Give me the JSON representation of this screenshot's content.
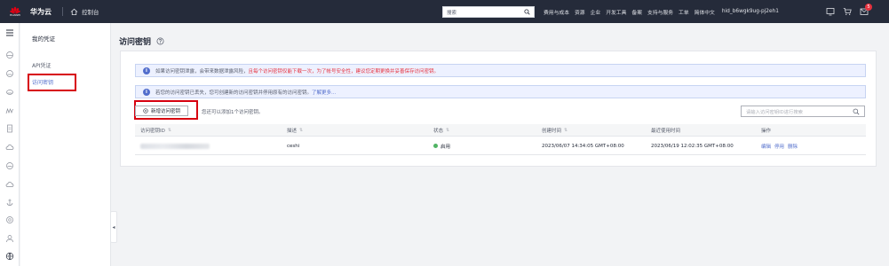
{
  "topbar": {
    "logo_text": "HUAWEI",
    "brand": "华为云",
    "console": "控制台",
    "search_placeholder": "搜索",
    "nav": [
      "费用与成本",
      "资源",
      "企业",
      "开发工具",
      "备案",
      "支持与服务",
      "工单",
      "简体中文"
    ],
    "user": "hid_b6wgk9ug-pj2eh1",
    "notification_count": "5"
  },
  "subnav": {
    "title": "我的凭证",
    "items": [
      "API凭证",
      "访问密钥"
    ]
  },
  "page": {
    "title": "访问密钥"
  },
  "notices": {
    "n1_prefix": "如果访问密钥泄露，会带来数据泄露风险，",
    "n1_red": "且每个访问密钥仅能下载一次，为了帐号安全性，建议您定期更换并妥善保存访问密钥。",
    "n2_text": "若您的访问密钥已丢失，您可创建新的访问密钥并停用原有的访问密钥。",
    "n2_link": "了解更多..."
  },
  "toolbar": {
    "create_label": "新增访问密钥",
    "quota_text": "您还可以添加1个访问密钥。",
    "search_placeholder": "请输入访问密钥ID进行搜索"
  },
  "table": {
    "headers": [
      "访问密钥ID",
      "描述",
      "状态",
      "创建时间",
      "最近使用时间",
      "操作"
    ],
    "rows": [
      {
        "description": "ceshi",
        "status": "启用",
        "created": "2023/06/07 14:34:05 GMT+08:00",
        "last_used": "2023/06/19 12:02:35 GMT+08:00",
        "ops": [
          "编辑",
          "停用",
          "删除"
        ]
      }
    ]
  },
  "colors": {
    "accent": "#526ecc",
    "topbar": "#252b3a",
    "highlight": "#d7000f",
    "status_ok": "#50b464"
  }
}
